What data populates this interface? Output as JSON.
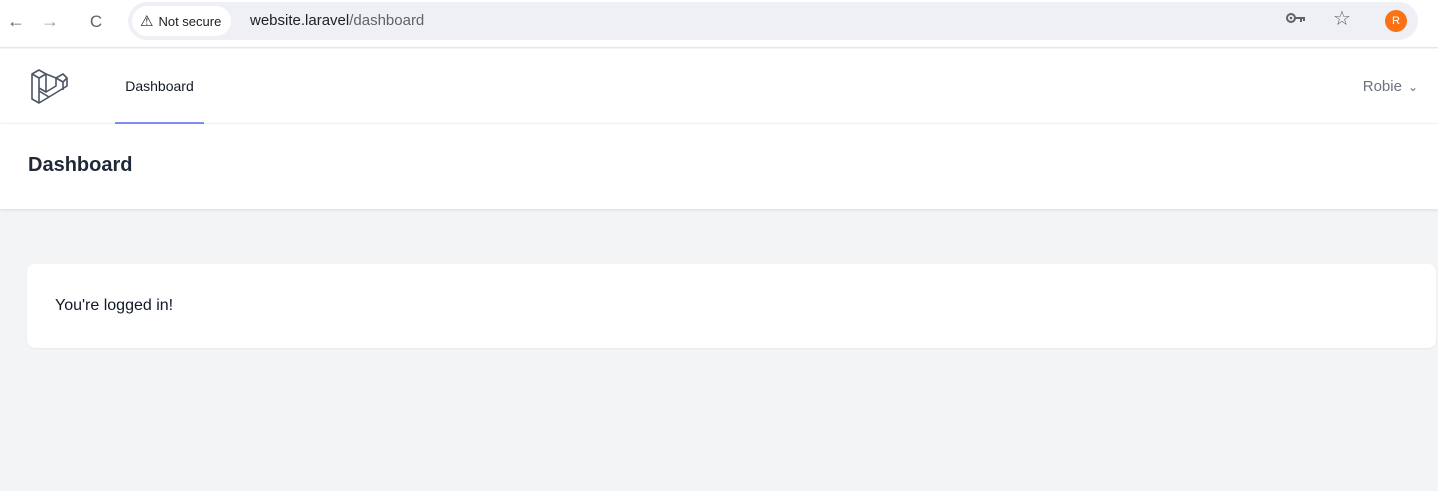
{
  "browser": {
    "security_label": "Not secure",
    "url_host": "website.laravel",
    "url_path": "/dashboard",
    "avatar_initial": "R",
    "avatar_color": "#f97316"
  },
  "nav": {
    "links": [
      {
        "label": "Dashboard",
        "active": true
      }
    ],
    "user_name": "Robie",
    "active_underline_color": "#818cf8"
  },
  "header": {
    "title": "Dashboard"
  },
  "content": {
    "message": "You're logged in!"
  }
}
